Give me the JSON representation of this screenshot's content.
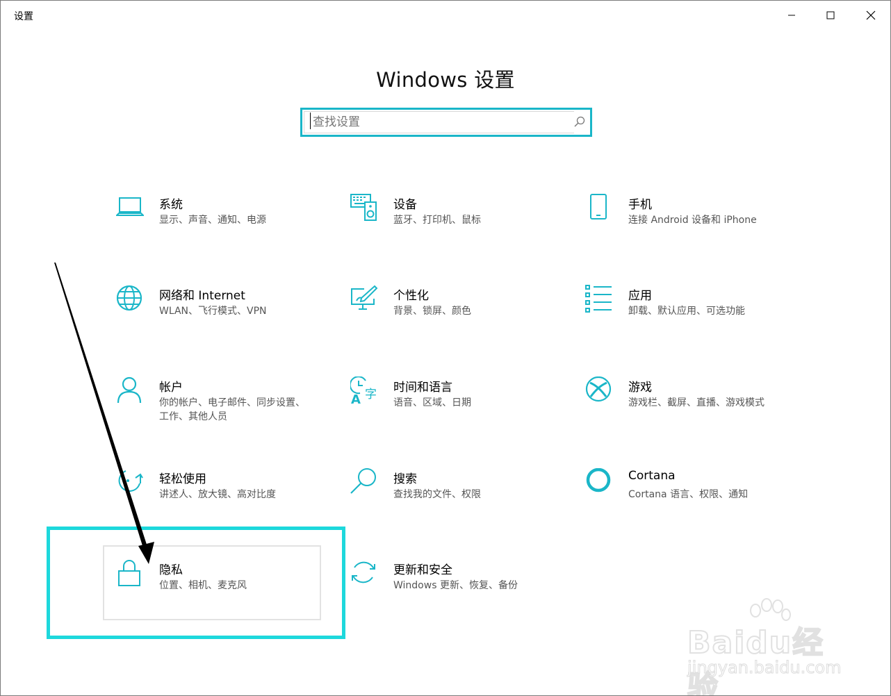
{
  "window": {
    "title": "设置",
    "page_title": "Windows 设置"
  },
  "search": {
    "placeholder": "查找设置"
  },
  "tiles": [
    {
      "name": "系统",
      "desc": "显示、声音、通知、电源",
      "icon": "laptop-icon"
    },
    {
      "name": "设备",
      "desc": "蓝牙、打印机、鼠标",
      "icon": "devices-icon"
    },
    {
      "name": "手机",
      "desc": "连接 Android 设备和 iPhone",
      "icon": "phone-icon"
    },
    {
      "name": "网络和 Internet",
      "desc": "WLAN、飞行模式、VPN",
      "icon": "globe-icon"
    },
    {
      "name": "个性化",
      "desc": "背景、锁屏、颜色",
      "icon": "personalization-icon"
    },
    {
      "name": "应用",
      "desc": "卸载、默认应用、可选功能",
      "icon": "apps-list-icon"
    },
    {
      "name": "帐户",
      "desc": "你的帐户、电子邮件、同步设置、工作、其他人员",
      "icon": "person-icon"
    },
    {
      "name": "时间和语言",
      "desc": "语音、区域、日期",
      "icon": "time-language-icon"
    },
    {
      "name": "游戏",
      "desc": "游戏栏、截屏、直播、游戏模式",
      "icon": "xbox-icon"
    },
    {
      "name": "轻松使用",
      "desc": "讲述人、放大镜、高对比度",
      "icon": "ease-of-access-icon"
    },
    {
      "name": "搜索",
      "desc": "查找我的文件、权限",
      "icon": "magnifier-icon"
    },
    {
      "name": "Cortana",
      "desc": "Cortana 语言、权限、通知",
      "icon": "cortana-circle-icon"
    },
    {
      "name": "隐私",
      "desc": "位置、相机、麦克风",
      "icon": "lock-icon"
    },
    {
      "name": "更新和安全",
      "desc": "Windows 更新、恢复、备份",
      "icon": "refresh-icon"
    }
  ],
  "watermark": {
    "brand": "Baidu经验",
    "url": "jingyan.baidu.com"
  },
  "colors": {
    "accent": "#1ab6c8",
    "highlight": "#1dd8dc"
  }
}
